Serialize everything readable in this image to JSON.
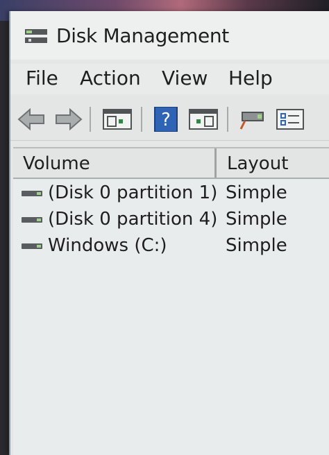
{
  "window": {
    "title": "Disk Management"
  },
  "menu": [
    "File",
    "Action",
    "View",
    "Help"
  ],
  "toolbar": {
    "buttons": [
      {
        "name": "back-arrow-icon"
      },
      {
        "name": "forward-arrow-icon"
      },
      {
        "name": "show-hide-console-tree-icon"
      },
      {
        "name": "help-icon"
      },
      {
        "name": "show-hide-action-pane-icon"
      },
      {
        "name": "connect-icon"
      },
      {
        "name": "properties-icon"
      }
    ]
  },
  "list": {
    "columns": [
      "Volume",
      "Layout"
    ],
    "rows": [
      {
        "volume": "(Disk 0 partition 1)",
        "layout": "Simple"
      },
      {
        "volume": "(Disk 0 partition 4)",
        "layout": "Simple"
      },
      {
        "volume": "Windows (C:)",
        "layout": "Simple"
      }
    ]
  },
  "colors": {
    "window_bg": "#e4e7e6",
    "help_blue": "#2f63b5"
  }
}
